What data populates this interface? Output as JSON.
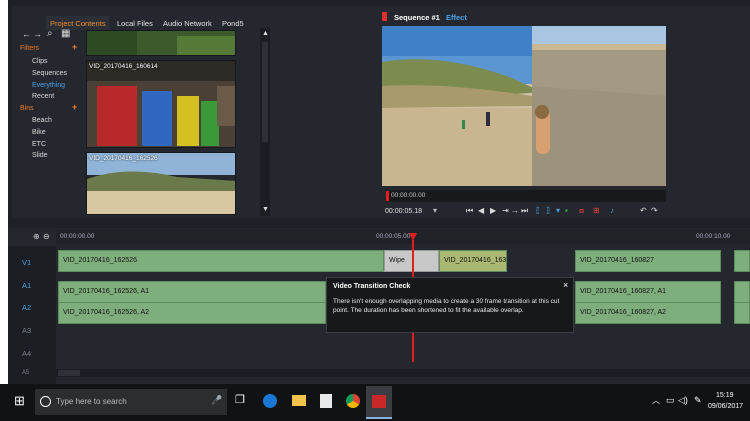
{
  "browser": {
    "tabs": [
      "Project Contents",
      "Local Files",
      "Audio Network",
      "Pond5"
    ]
  },
  "sidebar": {
    "filters_label": "Filters",
    "filters": [
      "Clips",
      "Sequences",
      "Everything",
      "Recent"
    ],
    "bins_label": "Bins",
    "bins": [
      "Beach",
      "Bike",
      "ETC",
      "Slide"
    ]
  },
  "thumbnails": [
    {
      "label": "VID_20170416_160614"
    },
    {
      "label": "VID_20170416_162526"
    }
  ],
  "viewer": {
    "sequence_label": "Sequence #1",
    "effect_label": "Effect",
    "scrub_time": "00:00:00.00",
    "current_time": "00:00:05.18"
  },
  "timeline": {
    "ruler": [
      "00:00:00.00",
      "00:00:05.00",
      "00:00:10.00"
    ],
    "tracks": [
      "V1",
      "A1",
      "A2",
      "A3",
      "A4",
      "A5"
    ],
    "clips": {
      "v1_a": "VID_20170416_162526",
      "wipe": "Wipe",
      "v1_b": "VID_20170416_163",
      "v1_c": "VID_20170416_160827",
      "a1_a": "VID_20170416_162526, A1",
      "a1_c": "VID_20170416_160827, A1",
      "a2_a": "VID_20170416_162526, A2",
      "a2_c": "VID_20170416_160827, A2"
    }
  },
  "dialog": {
    "title": "Video Transition Check",
    "close": "×",
    "message": "There isn't enough overlapping media to create a 30 frame transition at this cut point.  The duration has been shortened to fit the available overlap."
  },
  "taskbar": {
    "search_placeholder": "Type here to search",
    "time": "15:19",
    "date": "09/06/2017"
  },
  "colors": {
    "accent_orange": "#f07a28",
    "accent_blue": "#4aa0e6",
    "clip_green": "#7fae7d",
    "playhead_red": "#e02020"
  },
  "icons": {
    "back": "←",
    "forward": "→",
    "search": "⌕",
    "grid": "▦",
    "plus": "+",
    "scroll_up": "▲",
    "scroll_down": "▼",
    "dropdown": "▾",
    "start": "⊞",
    "mic": "🎤",
    "task_view": "❐"
  }
}
